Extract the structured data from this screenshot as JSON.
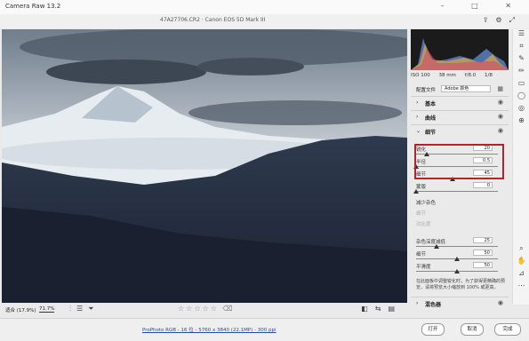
{
  "app": {
    "title": "Camera Raw 13.2"
  },
  "titlebar": {
    "buttons": [
      "–",
      "□",
      "✕"
    ]
  },
  "topbar": {
    "file_info": "47A27706.CR2 · Canon EOS 5D Mark III"
  },
  "exif": {
    "iso": "ISO 100",
    "focal": "38 mm",
    "aperture": "f/8.0",
    "shutter": "1/8"
  },
  "profile": {
    "label": "配置文件",
    "value": "Adobe 颜色"
  },
  "sections": {
    "basic": "基本",
    "curve": "曲线",
    "detail": "细节",
    "color_mixer": "混色器"
  },
  "detail": {
    "sharpen": {
      "label": "锐化",
      "value": "20",
      "level": 0.13
    },
    "radius": {
      "label": "半径",
      "value": "0.5",
      "level": 0.0
    },
    "detail": {
      "label": "细节",
      "value": "45",
      "level": 0.45
    },
    "mask": {
      "label": "蒙版",
      "value": "0",
      "level": 0.0
    },
    "noise_reduction": "减少杂色",
    "nr_detail": "细节",
    "nr_contrast": "对比度",
    "color_noise": {
      "label": "杂色深度减低",
      "value": "25",
      "level": 0.25
    },
    "cn_detail": {
      "label": "细节",
      "value": "50",
      "level": 0.5
    },
    "cn_smooth": {
      "label": "平滑度",
      "value": "50",
      "level": 0.5
    },
    "help": "在此面板中调整锐化时，为了获得更精确的预览，请将预览大小缩放到 100% 或更高。"
  },
  "bottom": {
    "zoom_fit": "适合 (17.9%)",
    "zoom_value": "71.7%"
  },
  "footer": {
    "info": "ProPhoto RGB - 16 位 - 5760 x 3840 (22.1MP) - 300 ppi",
    "open": "打开",
    "cancel": "取消",
    "done": "完成"
  },
  "colors": {
    "accent_red": "#b0242c"
  }
}
